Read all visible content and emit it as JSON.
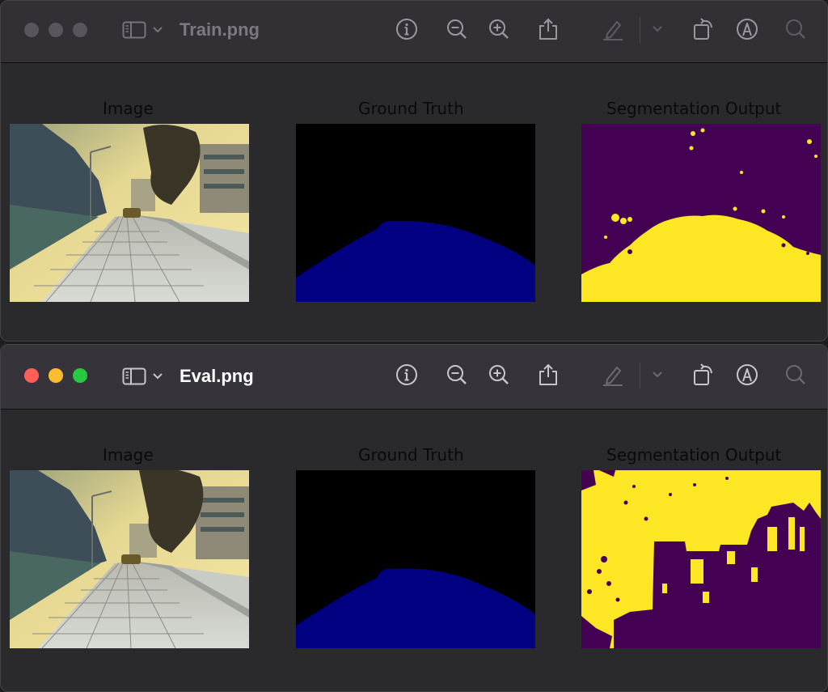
{
  "windows": [
    {
      "title": "Train.png",
      "active": false,
      "panels": [
        {
          "title": "Image"
        },
        {
          "title": "Ground Truth"
        },
        {
          "title": "Segmentation Output"
        }
      ]
    },
    {
      "title": "Eval.png",
      "active": true,
      "panels": [
        {
          "title": "Image"
        },
        {
          "title": "Ground Truth"
        },
        {
          "title": "Segmentation Output"
        }
      ]
    }
  ],
  "toolbar_icons": [
    "sidebar-icon",
    "info-icon",
    "zoom-out-icon",
    "zoom-in-icon",
    "share-icon",
    "markup-pen-icon",
    "dropdown-chevron-icon",
    "rotate-icon",
    "annotate-icon",
    "search-icon"
  ],
  "colors": {
    "segmentation_background": "#440154",
    "segmentation_foreground": "#fde725",
    "ground_truth_background": "#000000",
    "ground_truth_road": "#000080",
    "active_title": "#ffffff",
    "inactive_title": "#7c7a80"
  }
}
